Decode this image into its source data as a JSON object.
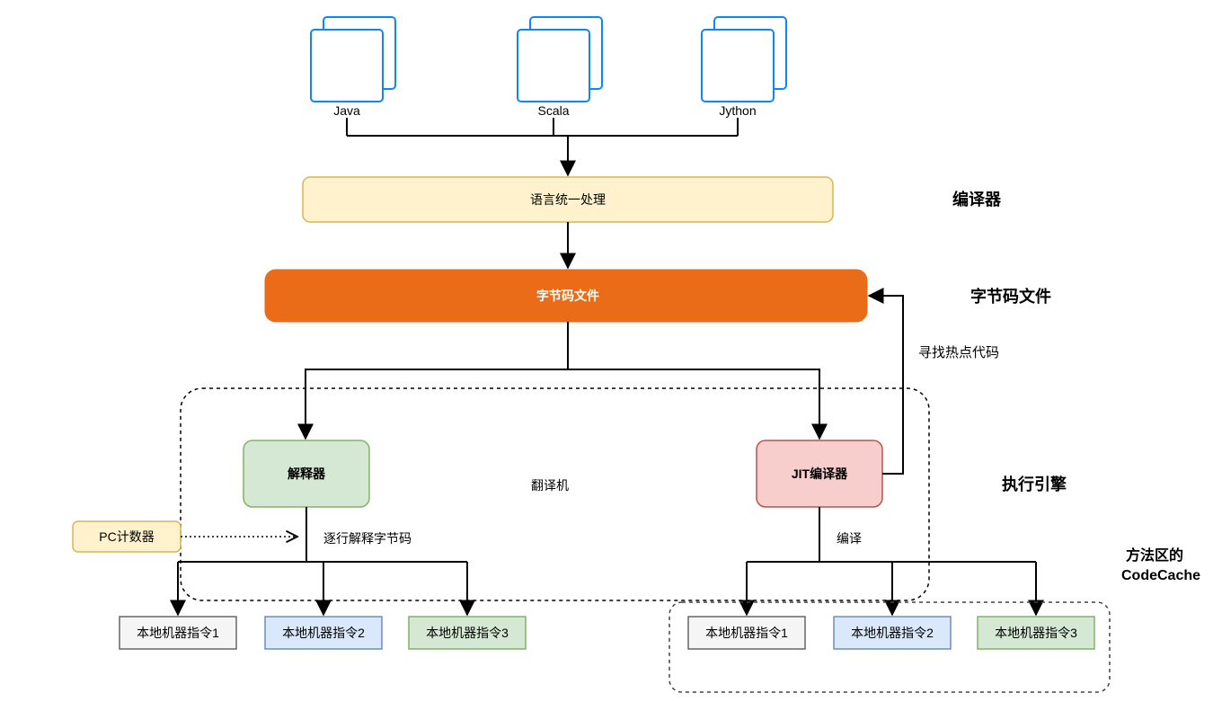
{
  "langs": {
    "java": "Java",
    "scala": "Scala",
    "jython": "Jython"
  },
  "unify": "语言统一处理",
  "bytecode": "字节码文件",
  "interpreter": "解释器",
  "jit": "JIT编译器",
  "pccounter": "PC计数器",
  "translator": "翻译机",
  "perline": "逐行解释字节码",
  "compile": "编译",
  "hotspot": "寻找热点代码",
  "instr": {
    "i1": "本地机器指令1",
    "i2": "本地机器指令2",
    "i3": "本地机器指令3"
  },
  "sideLabels": {
    "compiler": "编译器",
    "bytecode": "字节码文件",
    "engine": "执行引擎",
    "codecache1": "方法区的",
    "codecache2": "CodeCache"
  }
}
